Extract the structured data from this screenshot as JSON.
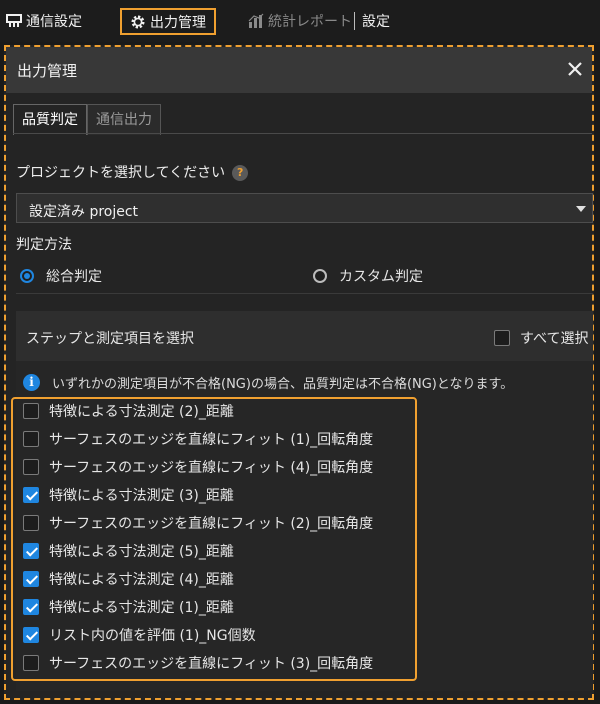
{
  "topmenu": {
    "items": [
      {
        "label": "通信設定",
        "icon": "network-icon"
      },
      {
        "label": "出力管理",
        "icon": "gear-icon"
      },
      {
        "label": "統計レポート",
        "icon": "chart-icon"
      },
      {
        "label": "設定"
      }
    ]
  },
  "dialog": {
    "title": "出力管理",
    "tabs": [
      "品質判定",
      "通信出力"
    ],
    "project_label": "プロジェクトを選択してください",
    "help_glyph": "?",
    "project_value": "設定済み project",
    "method_label": "判定方法",
    "methods": [
      {
        "label": "総合判定",
        "selected": true
      },
      {
        "label": "カスタム判定",
        "selected": false
      }
    ],
    "steps_header": "ステップと測定項目を選択",
    "select_all": "すべて選択",
    "info_glyph": "i",
    "info": "いずれかの測定項目が不合格(NG)の場合、品質判定は不合格(NG)となります。",
    "items": [
      {
        "label": "特徴による寸法測定 (2)_距離",
        "checked": false
      },
      {
        "label": "サーフェスのエッジを直線にフィット (1)_回転角度",
        "checked": false
      },
      {
        "label": "サーフェスのエッジを直線にフィット (4)_回転角度",
        "checked": false
      },
      {
        "label": "特徴による寸法測定 (3)_距離",
        "checked": true
      },
      {
        "label": "サーフェスのエッジを直線にフィット (2)_回転角度",
        "checked": false
      },
      {
        "label": "特徴による寸法測定 (5)_距離",
        "checked": true
      },
      {
        "label": "特徴による寸法測定 (4)_距離",
        "checked": true
      },
      {
        "label": "特徴による寸法測定 (1)_距離",
        "checked": true
      },
      {
        "label": "リスト内の値を評価 (1)_NG個数",
        "checked": true
      },
      {
        "label": "サーフェスのエッジを直線にフィット (3)_回転角度",
        "checked": false
      }
    ]
  },
  "colors": {
    "accent": "#f0a030",
    "check": "#1f86e0"
  }
}
